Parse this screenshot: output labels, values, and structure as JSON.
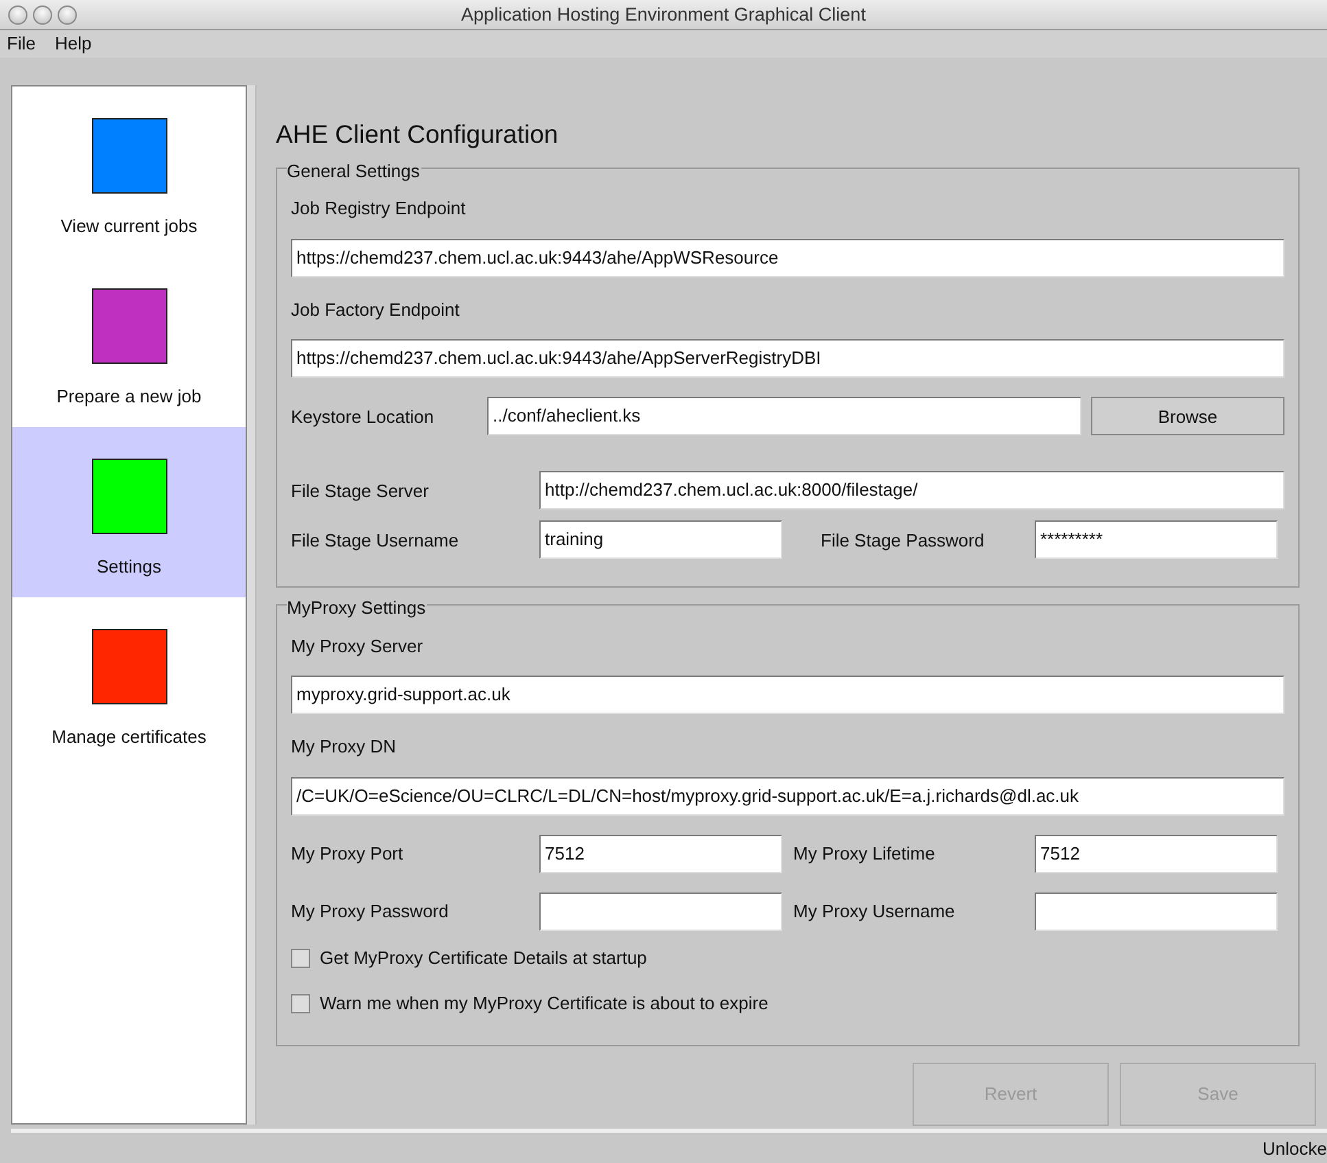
{
  "window": {
    "title": "Application Hosting Environment Graphical Client"
  },
  "menu": [
    "File",
    "Help"
  ],
  "sidebar": {
    "items": [
      {
        "label": "View current jobs",
        "color": "#0080ff",
        "selected": false
      },
      {
        "label": "Prepare a new job",
        "color": "#c030c0",
        "selected": false
      },
      {
        "label": "Settings",
        "color": "#00ff00",
        "selected": true
      },
      {
        "label": "Manage certificates",
        "color": "#ff2600",
        "selected": false
      }
    ]
  },
  "heading": "AHE Client Configuration",
  "sections": [
    {
      "title": "General Settings",
      "rows": [
        {
          "kind": "stacked",
          "label": "Job Registry Endpoint",
          "value": "https://chemd237.chem.ucl.ac.uk:9443/ahe/AppWSResource"
        },
        {
          "kind": "stacked",
          "label": "Job Factory Endpoint",
          "value": "https://chemd237.chem.ucl.ac.uk:9443/ahe/AppServerRegistryDBI"
        },
        {
          "kind": "browse",
          "label": "Keystore Location",
          "value": "../conf/aheclient.ks",
          "button": "Browse"
        },
        {
          "kind": "inline",
          "label": "File Stage Server",
          "value": "http://chemd237.chem.ucl.ac.uk:8000/filestage/"
        },
        {
          "kind": "pair",
          "fields": [
            {
              "label": "File Stage Username",
              "value": "training"
            },
            {
              "label": "File Stage Password",
              "value": "*********"
            }
          ]
        }
      ]
    },
    {
      "title": "MyProxy Settings",
      "rows": [
        {
          "kind": "stacked",
          "label": "My Proxy Server",
          "value": "myproxy.grid-support.ac.uk"
        },
        {
          "kind": "stacked",
          "label": "My Proxy DN",
          "value": "/C=UK/O=eScience/OU=CLRC/L=DL/CN=host/myproxy.grid-support.ac.uk/E=a.j.richards@dl.ac.uk"
        },
        {
          "kind": "pair",
          "fields": [
            {
              "label": "My Proxy Port",
              "value": "7512"
            },
            {
              "label": "My Proxy Lifetime",
              "value": "7512"
            }
          ]
        },
        {
          "kind": "pair",
          "fields": [
            {
              "label": "My Proxy Password"
            },
            {
              "label": "My Proxy Username"
            }
          ]
        },
        {
          "kind": "checkbox",
          "label": "Get MyProxy Certificate Details at startup",
          "checked": false
        },
        {
          "kind": "checkbox",
          "label": "Warn me when my MyProxy Certificate is about to expire",
          "checked": false
        }
      ]
    }
  ],
  "buttons": [
    {
      "label": "Revert",
      "disabled": true
    },
    {
      "label": "Save",
      "disabled": true
    }
  ],
  "status_bar": "Unlocke"
}
